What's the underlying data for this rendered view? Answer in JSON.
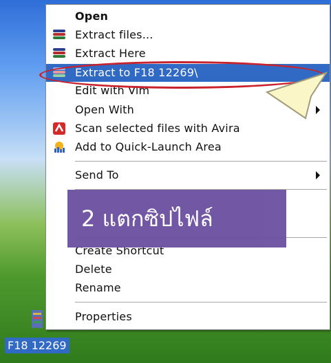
{
  "menu": {
    "items": [
      {
        "label": "Open",
        "icon": "none",
        "bold": true
      },
      {
        "label": "Extract files...",
        "icon": "winrar-books-icon"
      },
      {
        "label": "Extract Here",
        "icon": "winrar-books-icon"
      },
      {
        "label": "Extract to F18 12269\\",
        "icon": "winrar-books-icon",
        "selected": true
      },
      {
        "label": "Edit with Vim",
        "icon": "none"
      },
      {
        "label": "Open With",
        "icon": "none",
        "submenu": true
      },
      {
        "label": "Scan selected files with Avira",
        "icon": "avira-icon"
      },
      {
        "label": "Add to Quick-Launch Area",
        "icon": "quick-launch-icon"
      },
      {
        "label": "Send To",
        "icon": "none",
        "submenu": true
      },
      {
        "label": "Create Shortcut",
        "icon": "none"
      },
      {
        "label": "Delete",
        "icon": "none"
      },
      {
        "label": "Rename",
        "icon": "none"
      },
      {
        "label": "Properties",
        "icon": "none"
      }
    ]
  },
  "annotation": {
    "text": "2 แตกซิปไฟล์",
    "color": "#6b4fa0",
    "highlight_color": "#c8232c"
  },
  "desktop": {
    "file_label": "F18 12269",
    "selection_color": "#316ac5"
  }
}
